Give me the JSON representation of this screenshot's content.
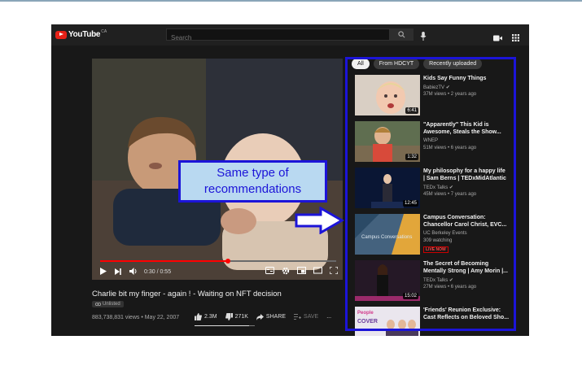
{
  "app": {
    "logo_text": "YouTube",
    "region": "CA",
    "search_placeholder": "Search"
  },
  "video": {
    "current_time": "0:30",
    "duration": "0:55",
    "progress": 0.54,
    "title": "Charlie bit my finger - again ! - Waiting on NFT decision",
    "unlisted_label": "Unlisted",
    "views_date": "883,738,831 views • May 22, 2007",
    "likes": "2.3M",
    "dislikes": "271K",
    "share_label": "SHARE",
    "save_label": "SAVE",
    "more_label": "..."
  },
  "sidebar": {
    "chips": [
      "All",
      "From HDCYT",
      "Recently uploaded"
    ],
    "recommendations": [
      {
        "title_lines": [
          "Kids Say Funny Things"
        ],
        "channel": "BabiezTV",
        "verified": true,
        "meta": "37M views • 2 years ago",
        "duration": "6:41",
        "live": false
      },
      {
        "title_lines": [
          "\"Apparently\" This Kid is",
          "Awesome, Steals the Show..."
        ],
        "channel": "WNEP",
        "verified": false,
        "meta": "51M views • 6 years ago",
        "duration": "1:32",
        "live": false
      },
      {
        "title_lines": [
          "My philosophy for a happy life",
          "| Sam Berns | TEDxMidAtlantic"
        ],
        "channel": "TEDx Talks",
        "verified": true,
        "meta": "45M views • 7 years ago",
        "duration": "12:45",
        "live": false
      },
      {
        "title_lines": [
          "Campus Conversation:",
          "Chancellor Carol Christ, EVC..."
        ],
        "channel": "UC Berkeley Events",
        "verified": false,
        "meta": "309 watching",
        "duration": "",
        "live": true,
        "live_label": "LIVE NOW"
      },
      {
        "title_lines": [
          "The Secret of Becoming",
          "Mentally Strong | Amy Morin |..."
        ],
        "channel": "TEDx Talks",
        "verified": true,
        "meta": "27M views • 6 years ago",
        "duration": "15:02",
        "live": false
      },
      {
        "title_lines": [
          "'Friends' Reunion Exclusive:",
          "Cast Reflects on Beloved Sho..."
        ],
        "channel": "",
        "verified": false,
        "meta": "",
        "duration": "",
        "live": false
      }
    ]
  },
  "annotation": {
    "line1": "Same type of",
    "line2": "recommendations",
    "color": "#1c14d8",
    "fill": "#b9d9f1"
  },
  "colors": {
    "brand_red": "#e62117",
    "background": "#181818"
  }
}
